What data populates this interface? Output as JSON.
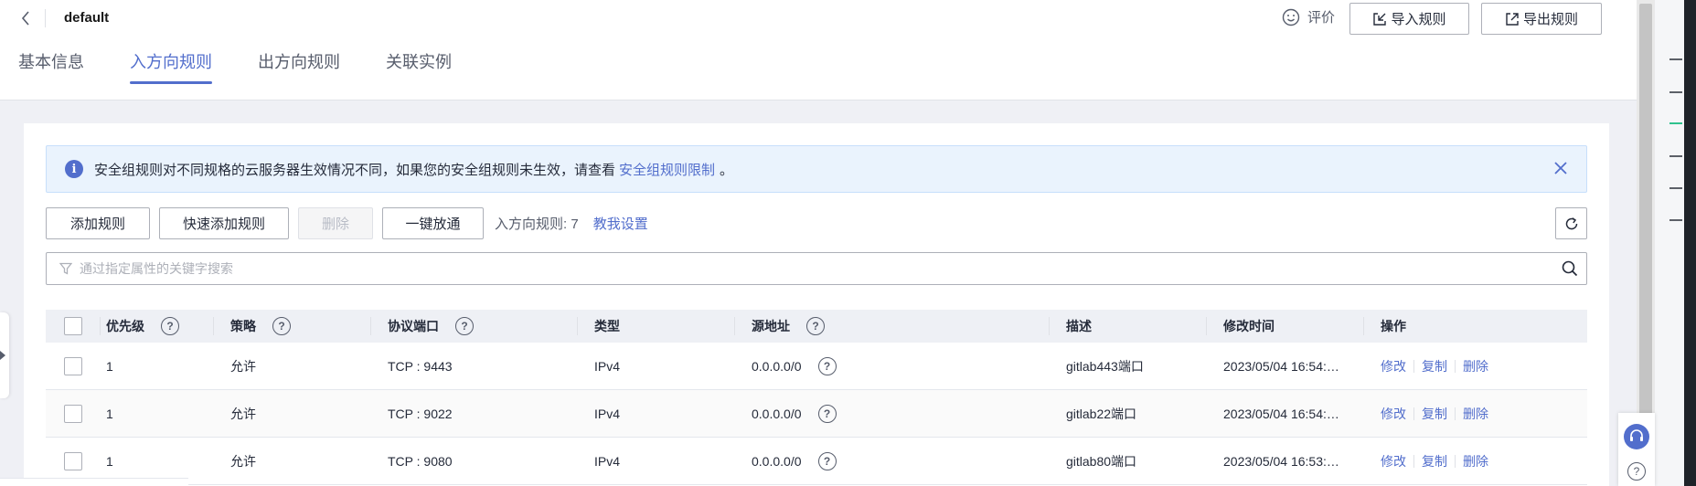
{
  "header": {
    "title": "default",
    "rate_label": "评价",
    "import_label": "导入规则",
    "export_label": "导出规则"
  },
  "tabs": [
    {
      "label": "基本信息"
    },
    {
      "label": "入方向规则"
    },
    {
      "label": "出方向规则"
    },
    {
      "label": "关联实例"
    }
  ],
  "notice": {
    "text": "安全组规则对不同规格的云服务器生效情况不同，如果您的安全组规则未生效，请查看",
    "link": "安全组规则限制",
    "tail": "。"
  },
  "toolbar": {
    "add_rule": "添加规则",
    "quick_add": "快速添加规则",
    "delete": "删除",
    "open_all": "一键放通",
    "count_label": "入方向规则: 7",
    "teach_link": "教我设置"
  },
  "search": {
    "placeholder": "通过指定属性的关键字搜索"
  },
  "table": {
    "columns": {
      "priority": "优先级",
      "action": "策略",
      "port": "协议端口",
      "type": "类型",
      "source": "源地址",
      "description": "描述",
      "modified": "修改时间",
      "operations": "操作"
    },
    "rows": [
      {
        "priority": "1",
        "action": "允许",
        "port": "TCP : 9443",
        "type": "IPv4",
        "source": "0.0.0.0/0",
        "description": "gitlab443端口",
        "modified": "2023/05/04 16:54:…",
        "op_edit": "修改",
        "op_copy": "复制",
        "op_delete": "删除"
      },
      {
        "priority": "1",
        "action": "允许",
        "port": "TCP : 9022",
        "type": "IPv4",
        "source": "0.0.0.0/0",
        "description": "gitlab22端口",
        "modified": "2023/05/04 16:54:…",
        "op_edit": "修改",
        "op_copy": "复制",
        "op_delete": "删除"
      },
      {
        "priority": "1",
        "action": "允许",
        "port": "TCP : 9080",
        "type": "IPv4",
        "source": "0.0.0.0/0",
        "description": "gitlab80端口",
        "modified": "2023/05/04 16:53:…",
        "op_edit": "修改",
        "op_copy": "复制",
        "op_delete": "删除"
      }
    ]
  },
  "help_mark": "?",
  "info_mark": "i",
  "colors": {
    "accent": "#526ecc",
    "notice_bg": "#eaf3fd",
    "page_bg": "#eff0f5"
  }
}
